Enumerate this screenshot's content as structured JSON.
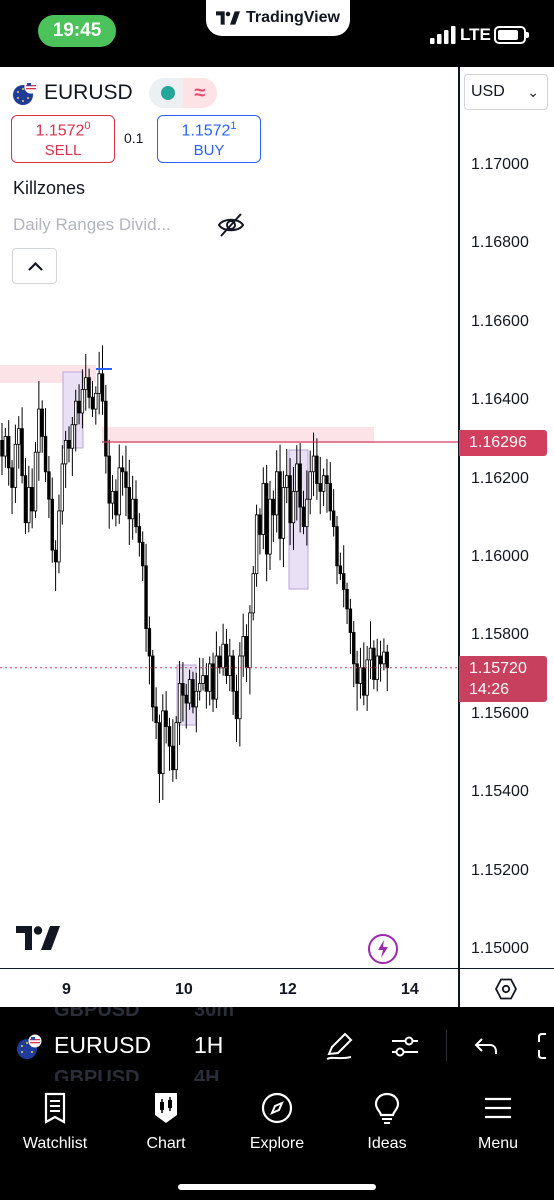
{
  "status_bar": {
    "time": "19:45",
    "app_name": "TradingView",
    "network": "LTE"
  },
  "header": {
    "symbol": "EURUSD",
    "sell": {
      "price_main": "1.1572",
      "price_sup": "0",
      "label": "SELL"
    },
    "buy": {
      "price_main": "1.1572",
      "price_sup": "1",
      "label": "BUY"
    },
    "spread": "0.1",
    "indicator_name": "Killzones",
    "hidden_indicator": "Daily Ranges Divid...",
    "currency": "USD"
  },
  "price_axis": {
    "ticks": [
      "1.17000",
      "1.16800",
      "1.16600",
      "1.16400",
      "1.16200",
      "1.16000",
      "1.15800",
      "1.15600",
      "1.15400",
      "1.15200",
      "1.15000"
    ],
    "level_tag": "1.16296",
    "last_price": "1.15720",
    "countdown": "14:26"
  },
  "time_axis": {
    "labels": [
      "9",
      "10",
      "12",
      "14"
    ]
  },
  "toolbar": {
    "symbol": "EURUSD",
    "interval": "1H",
    "ghost_items": [
      "GBPUSD",
      "30m",
      "GBPUSD",
      "4H"
    ]
  },
  "nav": {
    "items": [
      "Watchlist",
      "Chart",
      "Explore",
      "Ideas",
      "Menu"
    ]
  },
  "colors": {
    "sell": "#d9304c",
    "buy": "#2962ff",
    "level": "#d23f5e",
    "killzone": "#e9e0f6",
    "range": "#fbe3e8"
  },
  "chart_data": {
    "type": "candlestick",
    "symbol": "EURUSD",
    "interval": "1H",
    "ylim": [
      1.15,
      1.17
    ],
    "level_line": 1.16296,
    "last_price": 1.1572,
    "x_ticks": [
      "9",
      "10",
      "12",
      "14"
    ],
    "closes": [
      1.1626,
      1.1631,
      1.1623,
      1.1618,
      1.1629,
      1.1633,
      1.1621,
      1.1609,
      1.1618,
      1.1612,
      1.1627,
      1.1638,
      1.1631,
      1.1622,
      1.1615,
      1.1602,
      1.1599,
      1.1612,
      1.1624,
      1.163,
      1.1628,
      1.1634,
      1.164,
      1.1637,
      1.1643,
      1.1646,
      1.1641,
      1.1638,
      1.1642,
      1.1647,
      1.164,
      1.1626,
      1.1614,
      1.1617,
      1.1611,
      1.1623,
      1.1622,
      1.1618,
      1.161,
      1.1615,
      1.1608,
      1.1604,
      1.1598,
      1.1582,
      1.1575,
      1.1562,
      1.1558,
      1.1545,
      1.1561,
      1.1557,
      1.1552,
      1.1546,
      1.1558,
      1.1568,
      1.1565,
      1.1563,
      1.1569,
      1.1562,
      1.1566,
      1.1568,
      1.157,
      1.1566,
      1.1573,
      1.1564,
      1.1575,
      1.1572,
      1.1578,
      1.157,
      1.1575,
      1.1566,
      1.1559,
      1.1575,
      1.158,
      1.1572,
      1.1586,
      1.1596,
      1.1611,
      1.1606,
      1.1619,
      1.1601,
      1.1615,
      1.1611,
      1.1622,
      1.1605,
      1.1618,
      1.1621,
      1.1609,
      1.1617,
      1.1624,
      1.1613,
      1.1608,
      1.1615,
      1.1622,
      1.1626,
      1.1619,
      1.1617,
      1.1621,
      1.1619,
      1.1612,
      1.1608,
      1.1598,
      1.1596,
      1.1592,
      1.1587,
      1.1581,
      1.1573,
      1.1568,
      1.1572,
      1.1565,
      1.1574,
      1.1577,
      1.1569,
      1.1575,
      1.1573,
      1.1576,
      1.1572
    ]
  }
}
